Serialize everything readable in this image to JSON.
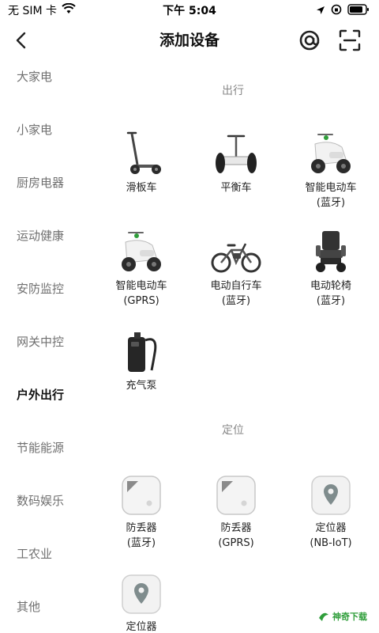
{
  "status_bar": {
    "carrier": "无 SIM 卡",
    "time": "下午 5:04"
  },
  "nav": {
    "title": "添加设备"
  },
  "sidebar": {
    "items": [
      {
        "label": "大家电",
        "active": false
      },
      {
        "label": "小家电",
        "active": false
      },
      {
        "label": "厨房电器",
        "active": false
      },
      {
        "label": "运动健康",
        "active": false
      },
      {
        "label": "安防监控",
        "active": false
      },
      {
        "label": "网关中控",
        "active": false
      },
      {
        "label": "户外出行",
        "active": true
      },
      {
        "label": "节能能源",
        "active": false
      },
      {
        "label": "数码娱乐",
        "active": false
      },
      {
        "label": "工农业",
        "active": false
      },
      {
        "label": "其他",
        "active": false
      }
    ]
  },
  "sections": [
    {
      "title": "出行",
      "devices": [
        {
          "name": "滑板车",
          "icon": "scooter-icon"
        },
        {
          "name": "平衡车",
          "icon": "balance-scooter-icon"
        },
        {
          "name": "智能电动车\n(蓝牙)",
          "icon": "e-scooter-bluetooth-icon"
        },
        {
          "name": "智能电动车\n(GPRS)",
          "icon": "e-scooter-gprs-icon"
        },
        {
          "name": "电动自行车\n(蓝牙)",
          "icon": "e-bike-icon"
        },
        {
          "name": "电动轮椅\n(蓝牙)",
          "icon": "wheelchair-icon"
        },
        {
          "name": "充气泵",
          "icon": "air-pump-icon"
        }
      ]
    },
    {
      "title": "定位",
      "devices": [
        {
          "name": "防丢器\n(蓝牙)",
          "icon": "tracker-tag-icon"
        },
        {
          "name": "防丢器\n(GPRS)",
          "icon": "tracker-tag-icon"
        },
        {
          "name": "定位器\n(NB-IoT)",
          "icon": "locator-pin-icon"
        },
        {
          "name": "定位器",
          "icon": "locator-pin-icon"
        }
      ]
    }
  ],
  "watermark": {
    "text": "神奇下载"
  },
  "colors": {
    "accent_green": "#2f9e3a",
    "sidebar_inactive": "#707070",
    "sidebar_active": "#111111"
  }
}
